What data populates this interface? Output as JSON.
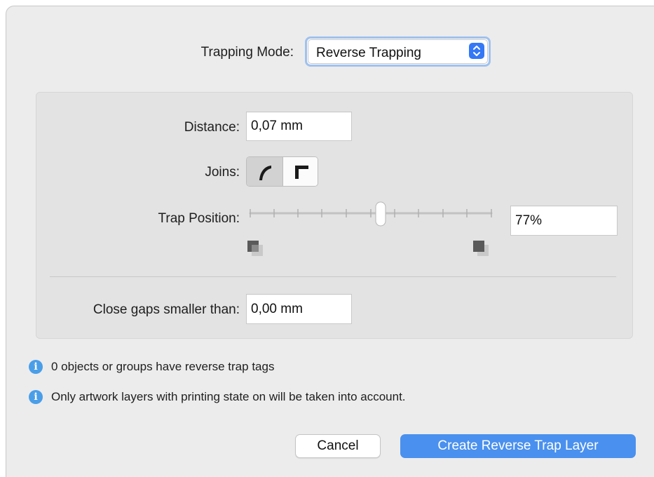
{
  "trapping_mode": {
    "label": "Trapping Mode:",
    "value": "Reverse Trapping"
  },
  "distance": {
    "label": "Distance:",
    "value": "0,07 mm"
  },
  "joins": {
    "label": "Joins:",
    "options": [
      "round-join-icon",
      "miter-join-icon"
    ],
    "selected": "round-join-icon"
  },
  "trap_position": {
    "label": "Trap Position:",
    "value": "77%",
    "slider_level": 0.5
  },
  "close_gaps": {
    "label": "Close gaps smaller than:",
    "value": "0,00 mm"
  },
  "info": [
    "0 objects or groups have reverse trap tags",
    "Only artwork layers with printing state on will be taken into account."
  ],
  "buttons": {
    "cancel": "Cancel",
    "create": "Create Reverse Trap Layer"
  },
  "colors": {
    "accent": "#3478f6",
    "primary_button": "#4a90ee",
    "info_icon": "#4a9ee8"
  }
}
